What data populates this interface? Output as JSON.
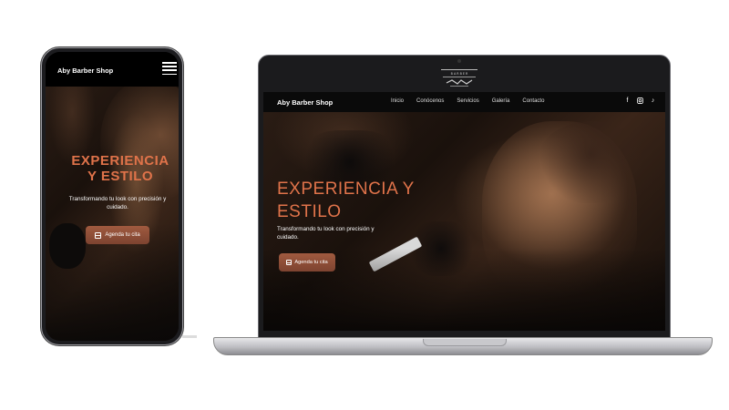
{
  "phone": {
    "brand": "Aby Barber Shop",
    "heading": "EXPERIENCIA Y ESTILO",
    "subtitle": "Transformando tu look con precisión y cuidado.",
    "cta_label": "Agenda tu cita",
    "menu_icon": "hamburger-icon"
  },
  "laptop": {
    "logo_text": "BARBER SHOP",
    "brand": "Aby Barber Shop",
    "nav": [
      "Inicio",
      "Conócenos",
      "Servicios",
      "Galería",
      "Contacto"
    ],
    "social_icons": [
      "facebook-icon",
      "instagram-icon",
      "tiktok-icon"
    ],
    "heading": "EXPERIENCIA Y ESTILO",
    "subtitle": "Transformando tu look con precisión y cuidado.",
    "cta_label": "Agenda tu cita"
  },
  "colors": {
    "accent": "#e0734a",
    "button": "#8f4d36",
    "background": "#000000"
  }
}
